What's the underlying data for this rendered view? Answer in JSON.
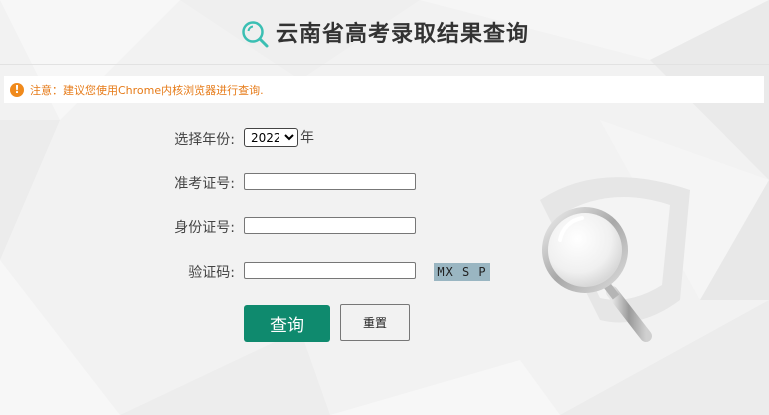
{
  "header": {
    "title": "云南省高考录取结果查询",
    "icon": "search-icon",
    "accent_color": "#3bbfb3"
  },
  "notice": {
    "icon": "exclamation-icon",
    "text": "注意：建议您使用Chrome内核浏览器进行查询.",
    "color": "#e67a17"
  },
  "form": {
    "year": {
      "label": "选择年份:",
      "selected": "2022",
      "suffix": "年"
    },
    "exam_number": {
      "label": "准考证号:",
      "value": ""
    },
    "id_number": {
      "label": "身份证号:",
      "value": ""
    },
    "captcha": {
      "label": "验证码:",
      "value": "",
      "code": "MX S P"
    }
  },
  "buttons": {
    "query": "查询",
    "reset": "重置",
    "query_color": "#0f8a6e"
  }
}
